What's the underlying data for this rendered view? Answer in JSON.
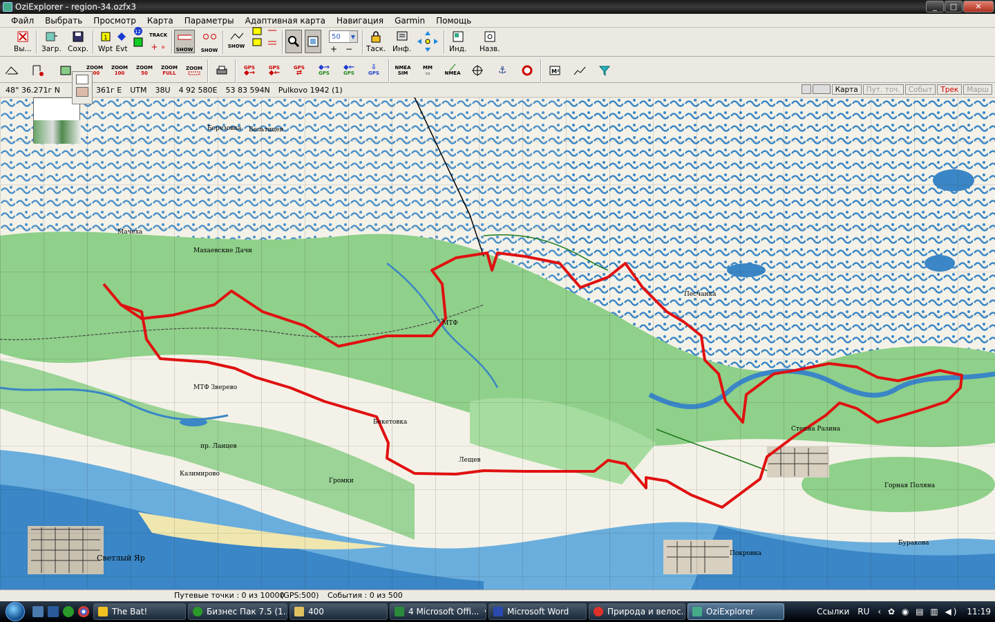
{
  "window": {
    "title": "OziExplorer - region-34.ozfx3",
    "buttons": [
      "_",
      "□",
      "✕"
    ]
  },
  "menu": [
    "Файл",
    "Выбрать",
    "Просмотр",
    "Карта",
    "Параметры",
    "Адаптивная карта",
    "Навигация",
    "Garmin",
    "Помощь"
  ],
  "toolbar1": {
    "exit_label": "Вы...",
    "load_label": "Загр.",
    "save_label": "Сохр.",
    "wpt_label": "Wpt",
    "evt_label": "Evt",
    "track_label": "TRACK",
    "show_label": "SHOW",
    "zoom_value": "50",
    "task_label": "Таск.",
    "info_label": "Инф.",
    "ind_label": "Инд.",
    "nav_label": "Назв."
  },
  "toolbar2": {
    "zoom_buttons": [
      {
        "top": "ZOOM",
        "bottom": "200"
      },
      {
        "top": "ZOOM",
        "bottom": "100"
      },
      {
        "top": "ZOOM",
        "bottom": "50"
      },
      {
        "top": "ZOOM",
        "bottom": "FULL"
      },
      {
        "top": "ZOOM",
        "bottom": ""
      }
    ],
    "gps_label": "GPS",
    "nmea_label": "NMEA",
    "nmea_sim": "SIM",
    "mm_label": "MM"
  },
  "coords": {
    "lat": "48° 36.271г N",
    "lon": "361г E",
    "utm_label": "UTM",
    "utm_zone": "38U",
    "easting": "4 92 580E",
    "northing": "53 83 594N",
    "datum": "Pulkovo 1942 (1)"
  },
  "mode_buttons": [
    "Карта",
    "Пут. точ.",
    "Событ",
    "Трек",
    "Марш"
  ],
  "map_labels": [
    "Мачеха",
    "Березовка",
    "Махаевские Дачи",
    "Бельтицев",
    "МТФ",
    "Песчанка",
    "Лещев",
    "МТФ Зверево",
    "Казимирово",
    "Громки",
    "Степна Разина",
    "Покровка",
    "Горная Поляна",
    "Светлый Яр",
    "Буракова",
    "пр. Ланцев",
    "Бекетовка"
  ],
  "status": {
    "waypoints": "Путевые точки : 0 из 10000",
    "gps": "(GPS:500)",
    "events": "События : 0 из 500"
  },
  "taskbar": {
    "tasks": [
      "The Bat!",
      "Бизнес Пак 7.5 (1...",
      "400",
      "4 Microsoft Offi...",
      "Microsoft Word",
      "Природа и велос...",
      "OziExplorer"
    ],
    "tray_links": "Ссылки",
    "lang": "RU",
    "time": "11:19"
  },
  "colors": {
    "track": "#e01010",
    "water": "#3a86c6",
    "forest": "#8fd08a",
    "paper": "#f4f2e8"
  }
}
